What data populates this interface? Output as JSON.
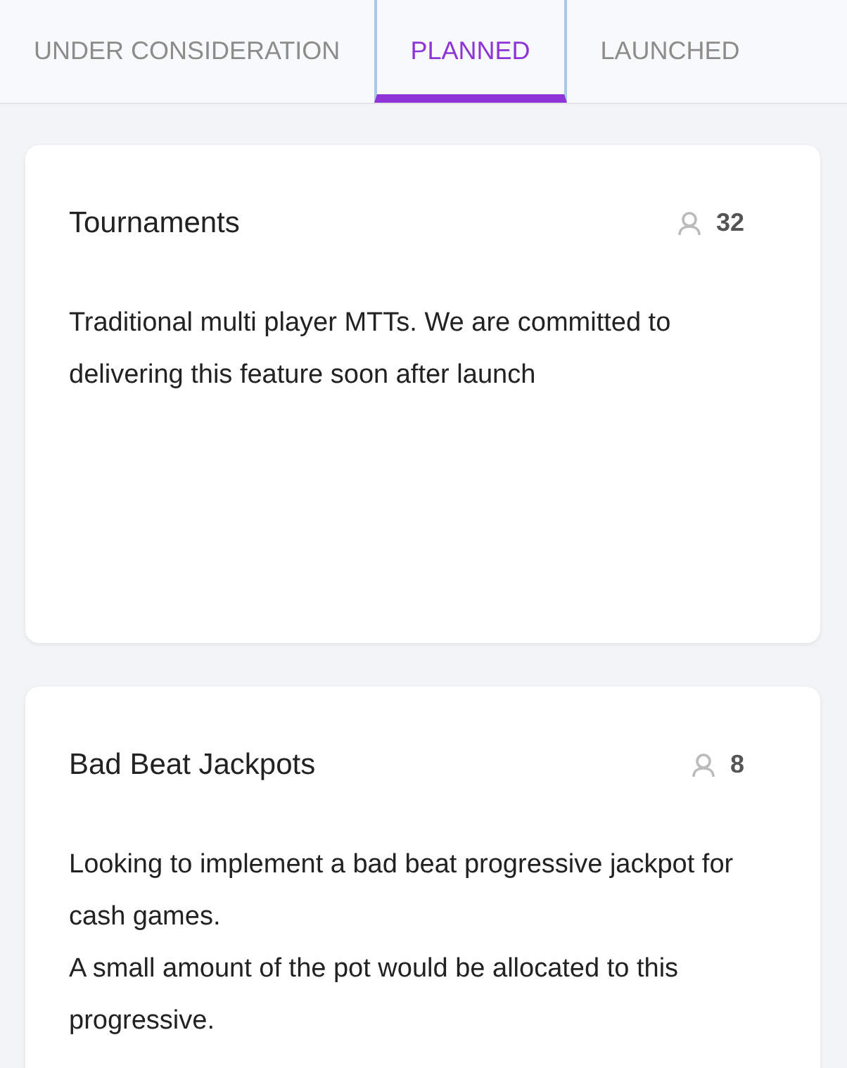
{
  "tabs": [
    {
      "label": "UNDER CONSIDERATION",
      "selected": false
    },
    {
      "label": "PLANNED",
      "selected": true
    },
    {
      "label": "LAUNCHED",
      "selected": false
    }
  ],
  "cards": [
    {
      "title": "Tournaments",
      "votes": "32",
      "lines": [
        "Traditional multi player MTTs. We are committed to delivering this feature soon after launch"
      ]
    },
    {
      "title": "Bad Beat Jackpots",
      "votes": "8",
      "lines": [
        "Looking to implement a bad beat progressive jackpot for cash games.",
        "A small amount of the pot would be allocated to this progressive."
      ]
    }
  ]
}
